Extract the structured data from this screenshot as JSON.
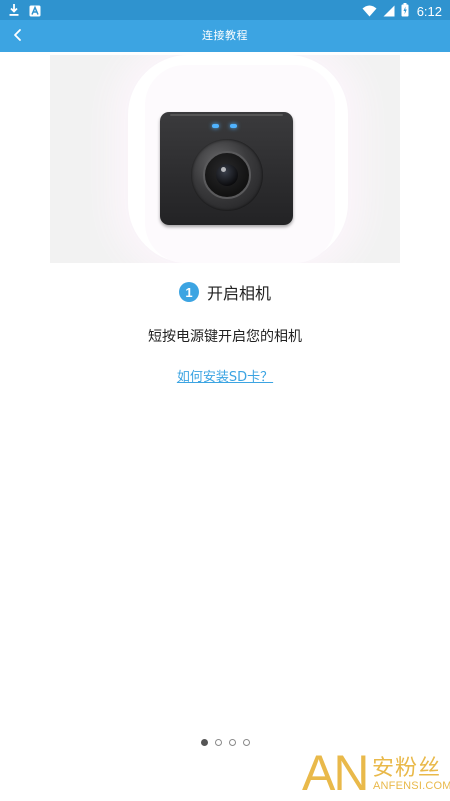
{
  "status_bar": {
    "time": "6:12",
    "icons": [
      "download-icon",
      "a-notification-icon",
      "wifi-icon",
      "signal-icon",
      "battery-icon"
    ]
  },
  "app_bar": {
    "title": "连接教程",
    "back_icon": "chevron-left-icon"
  },
  "step": {
    "number": "1",
    "title": "开启相机",
    "instruction": "短按电源键开启您的相机",
    "link": "如何安装SD卡？"
  },
  "pager": {
    "total": 4,
    "active": 0
  },
  "watermark": {
    "logo": "AN",
    "cn": "安粉丝",
    "en": "ANFENSI.COM"
  },
  "colors": {
    "status_bar": "#2f93cf",
    "app_bar": "#3ca4e2",
    "accent": "#3ca4e2",
    "watermark": "#e9b94a"
  }
}
